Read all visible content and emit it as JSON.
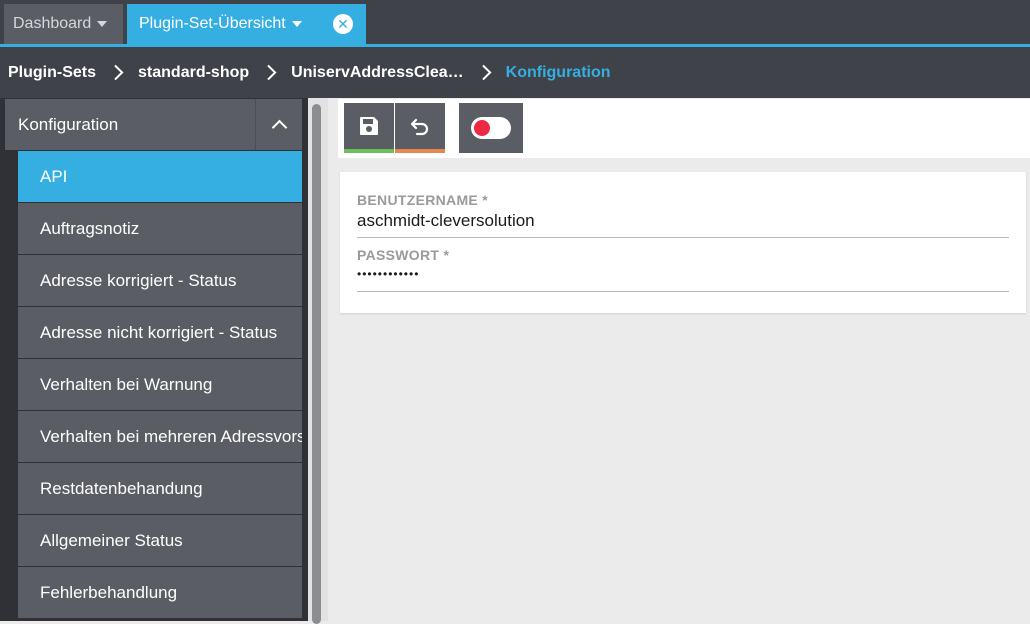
{
  "tabs": {
    "dashboard_label": "Dashboard",
    "plugin_set_label": "Plugin-Set-Übersicht"
  },
  "breadcrumb": {
    "items": [
      "Plugin-Sets",
      "standard-shop",
      "UniservAddressClea…",
      "Konfiguration"
    ]
  },
  "sidebar": {
    "title": "Konfiguration",
    "items": [
      {
        "label": "API",
        "active": true
      },
      {
        "label": "Auftragsnotiz"
      },
      {
        "label": "Adresse korrigiert - Status"
      },
      {
        "label": "Adresse nicht korrigiert - Status"
      },
      {
        "label": "Verhalten bei Warnung"
      },
      {
        "label": "Verhalten bei mehreren Adressvorschlägen"
      },
      {
        "label": "Restdatenbehandung"
      },
      {
        "label": "Allgemeiner Status"
      },
      {
        "label": "Fehlerbehandlung"
      }
    ]
  },
  "toolbar": {
    "save_icon": "floppy-disk-icon",
    "undo_icon": "undo-icon",
    "toggle_state": "off"
  },
  "form": {
    "username_label": "BENUTZERNAME *",
    "username_value": "aschmidt-cleversolution",
    "password_label": "PASSWORT *",
    "password_value": "••••••••••••"
  },
  "colors": {
    "accent": "#35aee2",
    "save": "#6cbf5a",
    "undo": "#e8874d",
    "toggle_dot": "#ee2a42"
  }
}
